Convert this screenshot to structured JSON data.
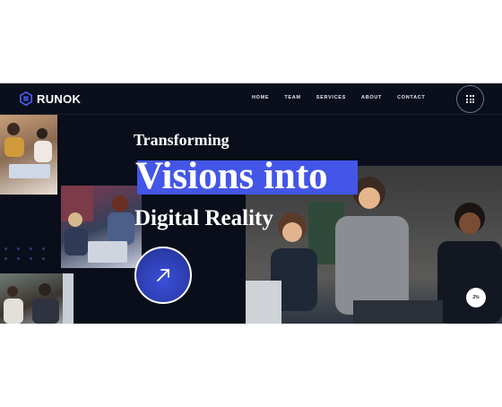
{
  "brand": {
    "name": "RUNOK",
    "accent": "#4356e8"
  },
  "nav": {
    "items": [
      "HOME",
      "TEAM",
      "SERVICES",
      "ABOUT",
      "CONTACT"
    ]
  },
  "menu_button": {
    "icon": "grid-menu-icon"
  },
  "hero": {
    "line1": "Transforming",
    "line2": "Visions into",
    "line3": "Digital Reality"
  },
  "cta": {
    "icon": "arrow-up-right-icon"
  },
  "scroll_progress": {
    "label": "2%",
    "value": 0.02
  }
}
